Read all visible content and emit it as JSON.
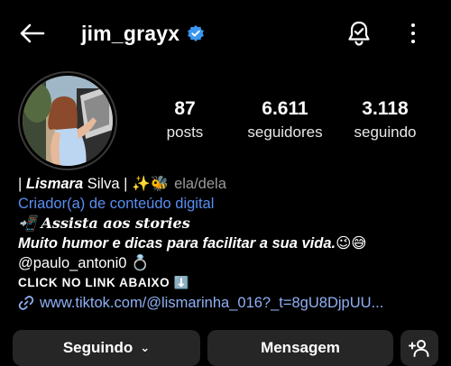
{
  "header": {
    "username": "jim_grayx",
    "verified": true,
    "icons": [
      "back-arrow-icon",
      "verified-badge-icon",
      "notification-bell-icon",
      "more-options-icon"
    ]
  },
  "stats": {
    "posts": {
      "count": "87",
      "label": "posts"
    },
    "followers": {
      "count": "6.611",
      "label": "seguidores"
    },
    "following": {
      "count": "3.118",
      "label": "seguindo"
    }
  },
  "bio": {
    "line1_prefix": "| ",
    "name_bold": "Lismara",
    "name_rest": " Silva | ✨🐝",
    "pronouns": "ela/dela",
    "category": "Criador(a) de conteúdo digital",
    "line3": "📲 Assista aos stories",
    "line4": "Muito humor e dicas para facilitar a sua vida.😉😅",
    "line5": "@paulo_antoni0 💍",
    "line6": "CLICK NO LINK ABAIXO ⬇️",
    "link": "www.tiktok.com/@lismarinha_016?_t=8gU8DjpUU..."
  },
  "actions": {
    "following_label": "Seguindo",
    "following_chevron": "⌄",
    "message_label": "Mensagem"
  },
  "colors": {
    "background": "#000000",
    "button_bg": "#262626",
    "verified_blue": "#3897f0",
    "category_blue": "#5a8ef0",
    "link_blue": "#8fb0f5"
  }
}
